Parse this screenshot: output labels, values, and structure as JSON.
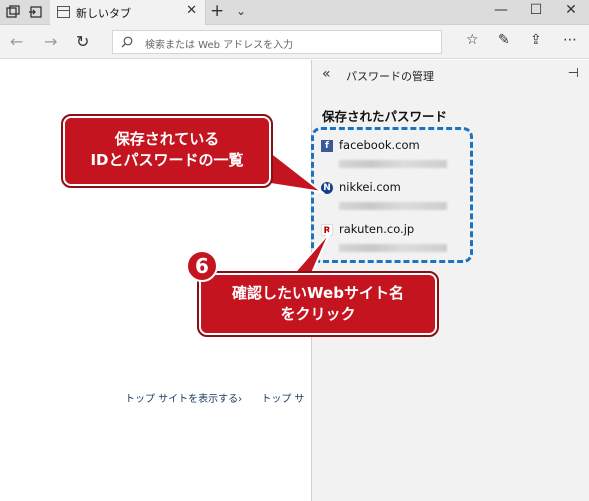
{
  "tabbar": {
    "tab_title": "新しいタブ",
    "new_tab": "+",
    "tab_list": "⌄",
    "window_controls": [
      "—",
      "☐",
      "✕"
    ]
  },
  "navbar": {
    "back": "←",
    "forward": "→",
    "refresh": "↻",
    "address_placeholder": "検索または Web アドレスを入力"
  },
  "panel": {
    "back": "«",
    "title": "パスワードの管理",
    "pin": "⊣",
    "heading": "保存されたパスワード",
    "items": [
      {
        "site": "facebook.com",
        "icon": "f"
      },
      {
        "site": "nikkei.com",
        "icon": "N"
      },
      {
        "site": "rakuten.co.jp",
        "icon": "R"
      }
    ]
  },
  "main": {
    "links": [
      "トップ サイトを表示する›",
      "トップ サ"
    ]
  },
  "annotations": {
    "callout1": [
      "保存されている",
      "IDとパスワードの一覧"
    ],
    "callout2": [
      "確認したいWebサイト名",
      "をクリック"
    ],
    "step": "6"
  }
}
